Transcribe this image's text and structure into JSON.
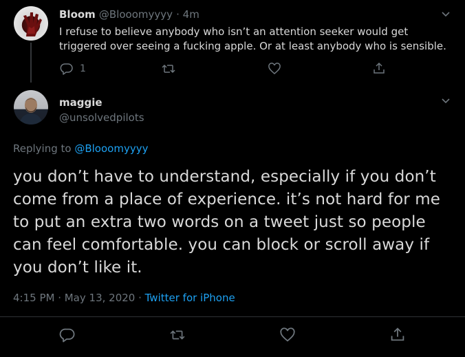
{
  "parent_tweet": {
    "name": "Bloom",
    "handle": "@Blooomyyyy",
    "time": "· 4m",
    "text": "I refuse to believe anybody who isn’t an attention seeker would get triggered over seeing a fucking apple. Or at least anybody who is sensible.",
    "reply_count": "1",
    "icons": [
      "reply-icon",
      "retweet-icon",
      "like-icon",
      "share-icon",
      "chevron-down-icon"
    ]
  },
  "main_tweet": {
    "name": "maggie",
    "handle": "@unsolvedpilots",
    "replying_prefix": "Replying to ",
    "replying_handle": "@Blooomyyyy",
    "text": "you don’t have to understand, especially if you don’t come from a place of experience. it’s not hard for me to put an extra two words on a tweet just so people can feel comfortable. you can block or scroll away if you don’t like it.",
    "timestamp": "4:15 PM · May 13, 2020 · ",
    "source": "Twitter for iPhone",
    "icons": [
      "reply-icon",
      "retweet-icon",
      "like-icon",
      "share-icon",
      "chevron-down-icon"
    ]
  },
  "colors": {
    "background": "#000000",
    "text": "#d9d9d9",
    "muted": "#6e767d",
    "accent": "#1da1f2",
    "divider": "#2f3336"
  }
}
